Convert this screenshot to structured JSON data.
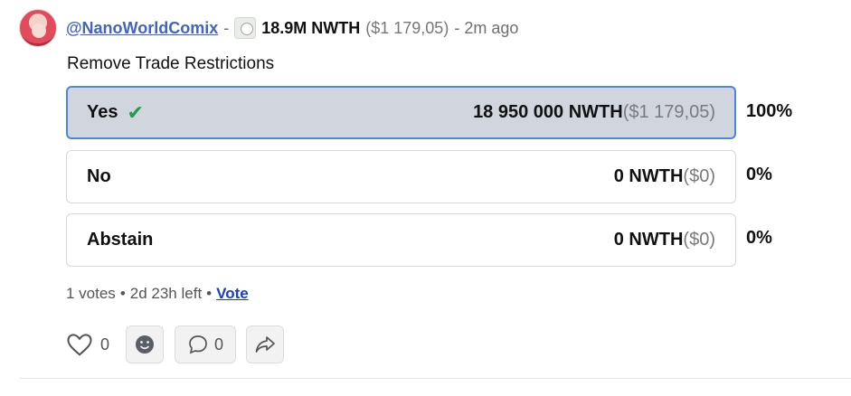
{
  "post": {
    "username": "@NanoWorldComix",
    "separator": "-",
    "token_amount": "18.9M NWTH",
    "token_usd": "($1 179,05)",
    "time": "- 2m ago",
    "icons": {
      "avatar": "user-avatar",
      "token": "token-icon"
    }
  },
  "poll": {
    "question": "Remove Trade Restrictions",
    "options": [
      {
        "label": "Yes",
        "amount": "18 950 000 NWTH",
        "usd": "($1 179,05)",
        "percent": "100%",
        "selected": true
      },
      {
        "label": "No",
        "amount": "0 NWTH",
        "usd": "($0)",
        "percent": "0%",
        "selected": false
      },
      {
        "label": "Abstain",
        "amount": "0 NWTH",
        "usd": "($0)",
        "percent": "0%",
        "selected": false
      }
    ],
    "votes_text": "1 votes",
    "time_left": "2d 23h left",
    "vote_link": "Vote",
    "dot": "•"
  },
  "actions": {
    "like_count": "0",
    "comment_count": "0",
    "icons": [
      "heart-icon",
      "emoji-icon",
      "comment-icon",
      "share-icon"
    ]
  },
  "colors": {
    "accent": "#4a86e8",
    "check": "#1f9d4c",
    "link": "#3f63c7"
  }
}
